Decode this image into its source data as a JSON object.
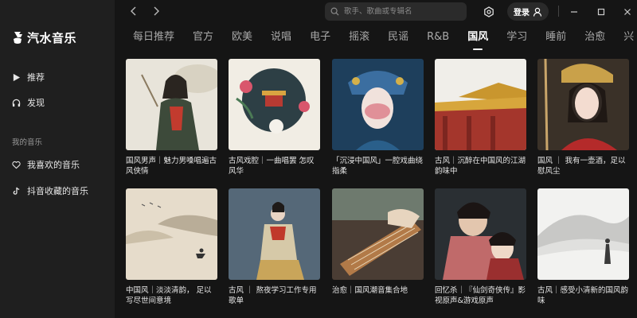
{
  "app": {
    "name": "汽水音乐"
  },
  "sidebar": {
    "items": [
      {
        "label": "推荐",
        "icon": "play-icon"
      },
      {
        "label": "发现",
        "icon": "headphones-icon"
      }
    ],
    "section_title": "我的音乐",
    "my_items": [
      {
        "label": "我喜欢的音乐",
        "icon": "heart-icon"
      },
      {
        "label": "抖音收藏的音乐",
        "icon": "tiktok-icon"
      }
    ]
  },
  "topbar": {
    "search_placeholder": "歌手、歌曲或专辑名",
    "login_label": "登录",
    "icons": [
      "back-arrow-icon",
      "forward-arrow-icon",
      "search-icon",
      "settings-hexagon-icon",
      "user-icon",
      "minimize-icon",
      "maximize-icon",
      "close-icon"
    ]
  },
  "categories": {
    "items": [
      "每日推荐",
      "官方",
      "欧美",
      "说唱",
      "电子",
      "摇滚",
      "民谣",
      "R&B",
      "国风",
      "学习",
      "睡前",
      "治愈",
      "兴"
    ],
    "active": "国风"
  },
  "playlists": [
    {
      "title": "国风男声｜魅力男嗓唱遍古风侠情"
    },
    {
      "title": "古风戏腔｜一曲唱罢 怎叹风华"
    },
    {
      "title": "「沉浸中国风」一腔戏曲绕指柔"
    },
    {
      "title": "古风｜沉醉在中国风的江湖韵味中"
    },
    {
      "title": "国风 ｜ 我有一壶酒，足以慰风尘"
    },
    {
      "title": "中国风｜淡淡清韵， 足以写尽世间意境"
    },
    {
      "title": "古风 ｜ 熬夜学习工作专用歌单"
    },
    {
      "title": "治愈｜国风潮音集合地"
    },
    {
      "title": "回忆杀｜『仙剑奇侠传』影视原声&游戏原声"
    },
    {
      "title": "古风｜感受小清新的国风韵味"
    }
  ]
}
